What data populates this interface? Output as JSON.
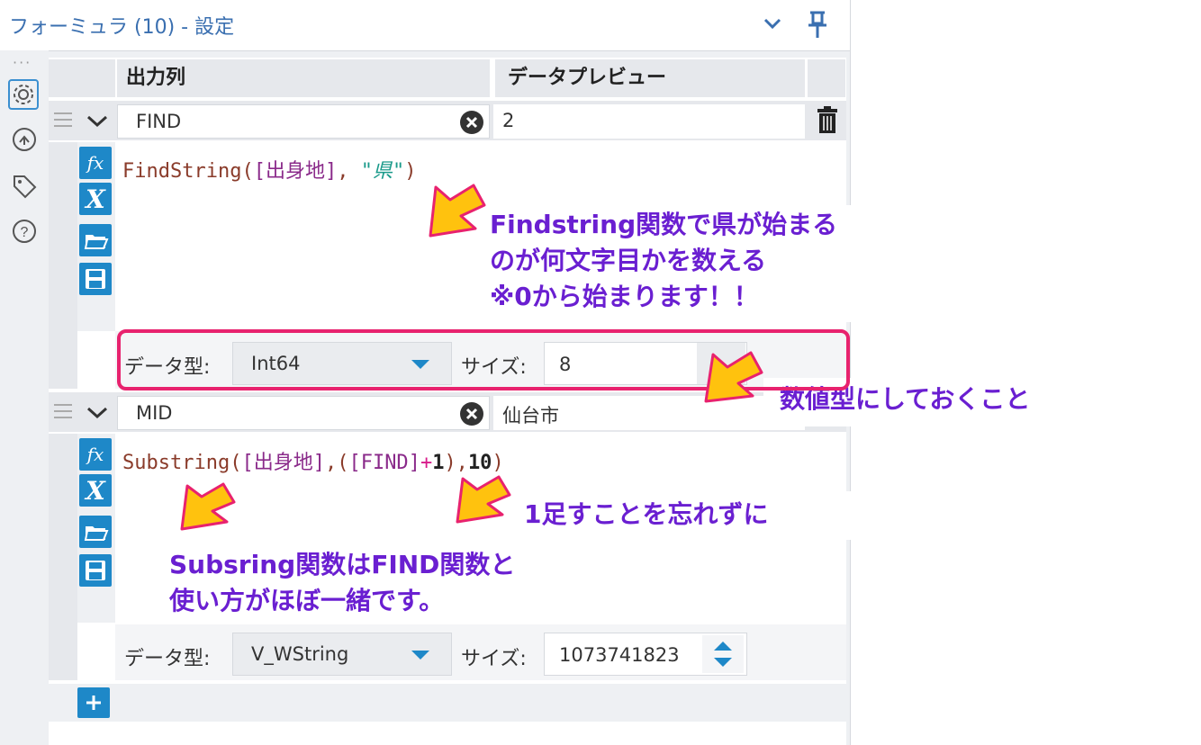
{
  "window": {
    "title": "フォーミュラ (10) - 設定"
  },
  "columns": {
    "output": "出力列",
    "preview": "データプレビュー"
  },
  "rows": [
    {
      "name": "FIND",
      "preview": "2",
      "formula_parts": [
        {
          "t": "FindString(",
          "c": "#8a3b2a"
        },
        {
          "t": "[出身地]",
          "c": "#8a2a8a"
        },
        {
          "t": ", ",
          "c": "#8a3b2a"
        },
        {
          "t": "\"県\"",
          "c": "#1a9a8a",
          "italic": true
        },
        {
          "t": ")",
          "c": "#8a3b2a"
        }
      ],
      "datatype_label": "データ型:",
      "datatype": "Int64",
      "size_label": "サイズ:",
      "size": "8"
    },
    {
      "name": "MID",
      "preview": "仙台市",
      "formula_parts": [
        {
          "t": "Substring(",
          "c": "#8a3b2a"
        },
        {
          "t": "[出身地]",
          "c": "#8a2a8a"
        },
        {
          "t": ",(",
          "c": "#8a3b2a"
        },
        {
          "t": "[FIND]",
          "c": "#8a2a8a"
        },
        {
          "t": "+",
          "c": "#d81b8a"
        },
        {
          "t": "1",
          "c": "#222222",
          "bold": true
        },
        {
          "t": "),",
          "c": "#8a3b2a"
        },
        {
          "t": "10",
          "c": "#222222",
          "bold": true
        },
        {
          "t": ")",
          "c": "#8a3b2a"
        }
      ],
      "datatype_label": "データ型:",
      "datatype": "V_WString",
      "size_label": "サイズ:",
      "size": "1073741823"
    }
  ],
  "annotations": {
    "find_note": [
      "Findstring関数で県が始まる",
      "のが何文字目かを数える",
      "※0から始まります！！"
    ],
    "numeric_note": "数値型にしておくこと",
    "plus_one_note": "1足すことを忘れずに",
    "substring_note": [
      "Subsring関数はFIND関数と",
      "使い方がほぼ一緒です。"
    ]
  },
  "icons": [
    "chevron-down-icon",
    "pin-icon",
    "gear-icon",
    "share-icon",
    "tag-icon",
    "help-icon",
    "drag-handle-icon",
    "clear-icon",
    "trash-icon",
    "fx-icon",
    "variable-icon",
    "folder-icon",
    "save-icon",
    "plus-icon",
    "arrow-icon"
  ],
  "colors": {
    "accent": "#1e88c8",
    "annotation_text": "#6a1fd1",
    "highlight_border": "#e8226e",
    "arrow_fill": "#ffc20e"
  }
}
